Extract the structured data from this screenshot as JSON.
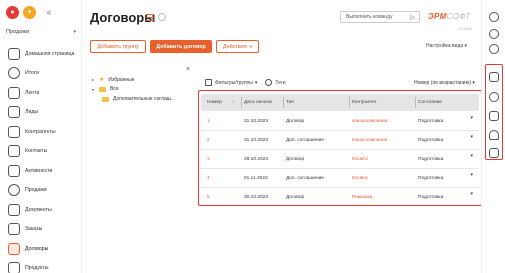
{
  "sidebar": {
    "app_select": "Продажи",
    "items": [
      {
        "label": "Домашняя страница",
        "icon": "home-icon"
      },
      {
        "label": "Итоги",
        "icon": "chart-icon"
      },
      {
        "label": "Лента",
        "icon": "feed-icon"
      },
      {
        "label": "Лиды",
        "icon": "lead-icon"
      },
      {
        "label": "Контрагенты",
        "icon": "company-icon"
      },
      {
        "label": "Контакты",
        "icon": "contacts-icon"
      },
      {
        "label": "Активности",
        "icon": "activity-icon"
      },
      {
        "label": "Продажи",
        "icon": "sales-icon"
      },
      {
        "label": "Документы",
        "icon": "documents-icon"
      },
      {
        "label": "Заказы",
        "icon": "orders-icon"
      },
      {
        "label": "Договоры",
        "icon": "contracts-icon",
        "active": true
      },
      {
        "label": "Продукты",
        "icon": "products-icon"
      }
    ]
  },
  "header": {
    "title": "Договоры",
    "command_placeholder": "Выполнить команду",
    "logo_main": "ЭРМ",
    "logo_soft": "СОФТ",
    "version": "3.3.0.001"
  },
  "actions": {
    "add_group": "Добавить группу",
    "add_contract": "Добавить договор",
    "actions_menu": "Действия",
    "view_settings": "Настройка вида"
  },
  "tree": {
    "favorites": "Избранные",
    "all": "Все",
    "subgroup": "Дополнительные соглаш..."
  },
  "toolbar": {
    "filters": "Фильтры/группы",
    "tags": "Теги",
    "sort": "Номер (по возрастанию)"
  },
  "table": {
    "columns": [
      "Номер",
      "Дата начала",
      "Тип",
      "Контрагент",
      "Состояние"
    ],
    "rows": [
      {
        "num": "1",
        "date": "31.10.2023",
        "type": "Договор",
        "counterparty": "Наша компания",
        "state": "Подготовка"
      },
      {
        "num": "2",
        "date": "31.10.2023",
        "type": "Доп. соглашение",
        "counterparty": "Наша компания",
        "state": "Подготовка"
      },
      {
        "num": "3",
        "date": "28.10.2023",
        "type": "Договор",
        "counterparty": "Космос",
        "state": "Подготовка"
      },
      {
        "num": "4",
        "date": "01.11.2023",
        "type": "Доп. соглашение",
        "counterparty": "Космос",
        "state": "Подготовка"
      },
      {
        "num": "5",
        "date": "30.10.2023",
        "type": "Договор",
        "counterparty": "Ромашка",
        "state": "Подготовка"
      }
    ]
  },
  "colors": {
    "accent": "#e8602c",
    "highlight": "#e53935",
    "header_bg": "#e5e5e5"
  }
}
